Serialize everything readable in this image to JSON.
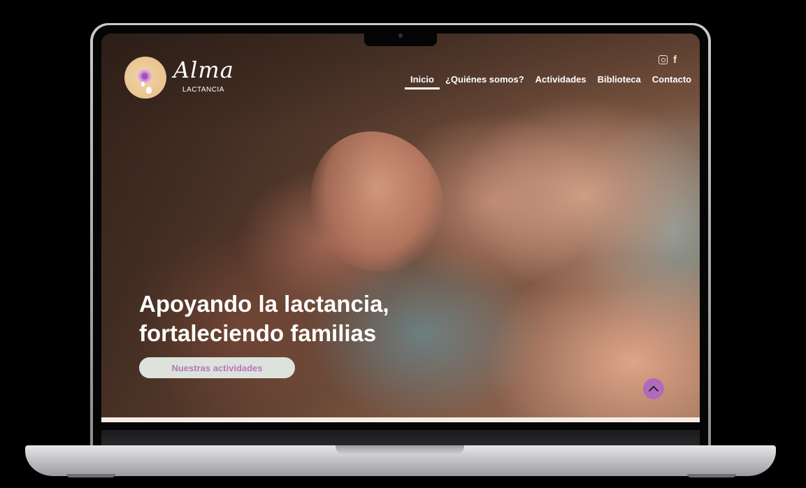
{
  "brand": {
    "name": "Alma",
    "tagline": "LACTANCIA"
  },
  "nav": {
    "items": [
      {
        "label": "Inicio",
        "active": true
      },
      {
        "label": "¿Quiénes somos?",
        "active": false
      },
      {
        "label": "Actividades",
        "active": false
      },
      {
        "label": "Biblioteca",
        "active": false
      },
      {
        "label": "Contacto",
        "active": false
      }
    ]
  },
  "social": {
    "icons": [
      "instagram-icon",
      "facebook-icon"
    ]
  },
  "hero": {
    "title_line1": "Apoyando la lactancia,",
    "title_line2": "fortaleciendo familias",
    "cta_label": "Nuestras actividades"
  },
  "colors": {
    "accent": "#b16bbb",
    "cta_bg": "#dde3dc",
    "cta_text": "#b774bc",
    "logo_bg": "#e9c48f"
  }
}
